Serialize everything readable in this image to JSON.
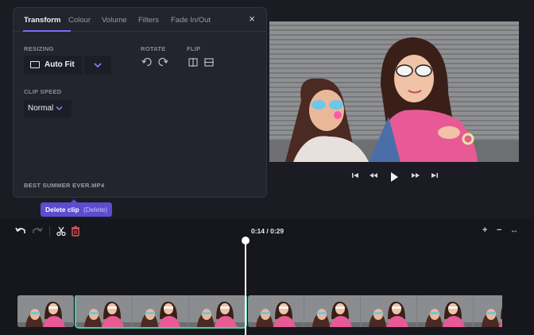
{
  "panel": {
    "tabs": [
      "Transform",
      "Colour",
      "Volume",
      "Filters",
      "Fade In/Out"
    ],
    "active_tab": "Transform",
    "close_label": "×",
    "resizing_label": "RESIZING",
    "resize_value": "Auto Fit",
    "rotate_label": "ROTATE",
    "flip_label": "FLIP",
    "clip_speed_label": "CLIP SPEED",
    "clip_speed_value": "Normal",
    "filename": "BEST SUMMER EVER.MP4"
  },
  "tooltip": {
    "label": "Delete clip",
    "shortcut": "(Delete)"
  },
  "transport": {
    "icons": [
      "skip-back-icon",
      "rewind-icon",
      "play-icon",
      "fast-forward-icon",
      "skip-forward-icon"
    ]
  },
  "timeline": {
    "timecode": "0:14 / 0:29",
    "zoom_in": "+",
    "zoom_out": "−",
    "zoom_fit": "↔",
    "playhead_progress": 0.48,
    "clips": [
      {
        "frames": 1,
        "selected": false
      },
      {
        "frames": 3,
        "selected": true
      },
      {
        "frames": 5,
        "selected": false
      }
    ]
  },
  "colors": {
    "accent": "#7c6cf0",
    "tooltip": "#5f4bd0",
    "selected_clip": "#3fd1a5",
    "delete_icon": "#e05a5a"
  }
}
